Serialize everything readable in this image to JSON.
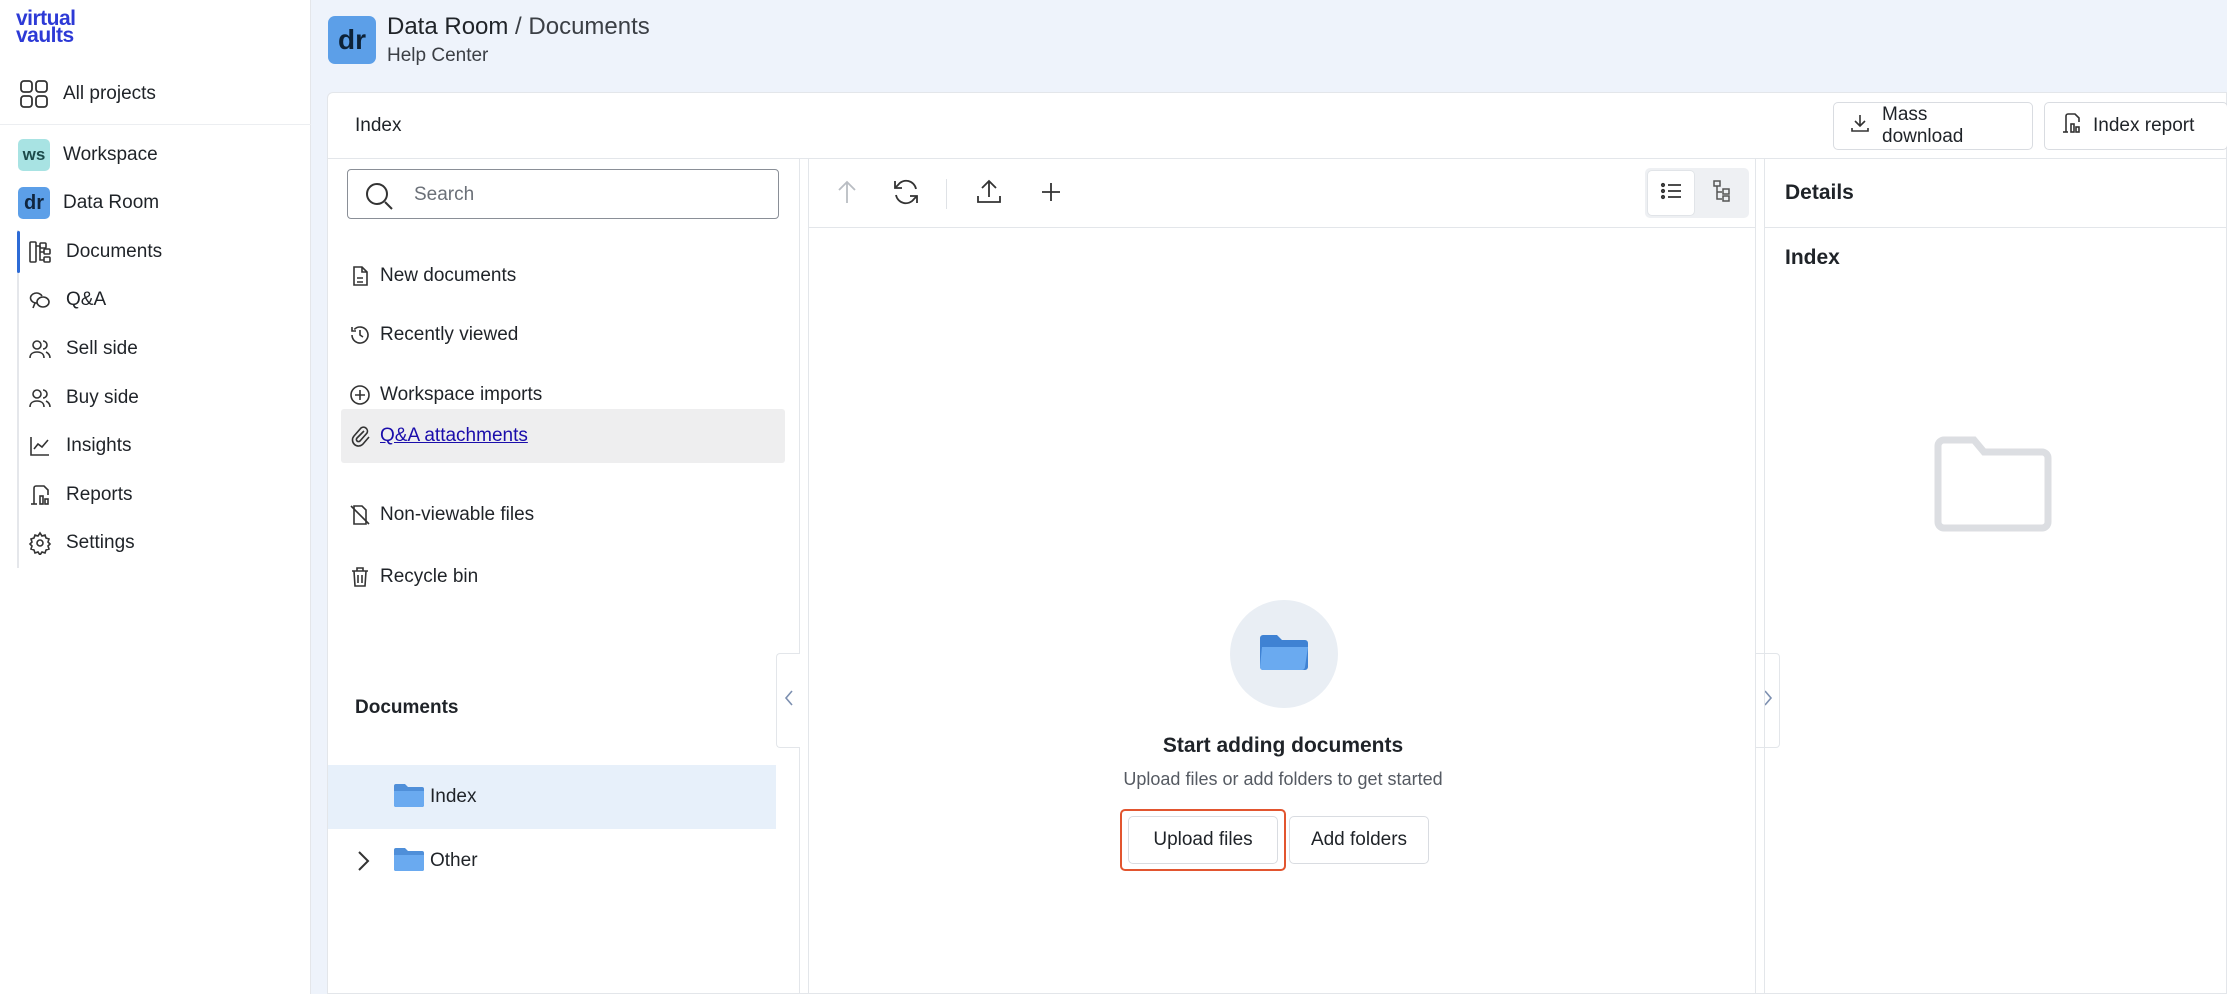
{
  "brand": {
    "line1": "virtual",
    "line2": "vaults"
  },
  "nav": {
    "all_projects": "All projects",
    "workspace": {
      "badge": "ws",
      "label": "Workspace"
    },
    "data_room": {
      "badge": "dr",
      "label": "Data Room"
    },
    "items": [
      {
        "label": "Documents",
        "icon": "documents-tree-icon",
        "active": true
      },
      {
        "label": "Q&A",
        "icon": "chat-bubbles-icon"
      },
      {
        "label": "Sell side",
        "icon": "users-icon"
      },
      {
        "label": "Buy side",
        "icon": "users-icon"
      },
      {
        "label": "Insights",
        "icon": "line-chart-icon"
      },
      {
        "label": "Reports",
        "icon": "report-icon"
      },
      {
        "label": "Settings",
        "icon": "gear-icon"
      }
    ]
  },
  "header": {
    "badge": "dr",
    "project": "Data Room",
    "separator": " / ",
    "section": "Documents",
    "subtitle": "Help Center"
  },
  "card": {
    "title": "Index",
    "mass_download": "Mass download",
    "index_report": "Index report"
  },
  "tree": {
    "search_placeholder": "Search",
    "items": [
      {
        "label": "New documents",
        "icon": "new-document-icon"
      },
      {
        "label": "Recently viewed",
        "icon": "history-icon"
      },
      {
        "label": "Workspace imports",
        "icon": "plus-circle-icon"
      },
      {
        "label": "Q&A attachments",
        "icon": "paperclip-icon",
        "selected": true
      },
      {
        "label": "Non-viewable files",
        "icon": "file-off-icon"
      },
      {
        "label": "Recycle bin",
        "icon": "trash-icon"
      }
    ],
    "documents_heading": "Documents",
    "folders": [
      {
        "label": "Index",
        "selected": true
      },
      {
        "label": "Other",
        "expandable": true
      }
    ]
  },
  "empty_state": {
    "title": "Start adding documents",
    "subtitle": "Upload files or add folders to get started",
    "upload_button": "Upload files",
    "add_folders_button": "Add folders"
  },
  "details": {
    "title": "Details",
    "item_name": "Index"
  },
  "colors": {
    "brand": "#2d3ad6",
    "accent_blue": "#5c9fe8",
    "highlight": "#e2552f",
    "main_bg": "#eef3fb"
  }
}
